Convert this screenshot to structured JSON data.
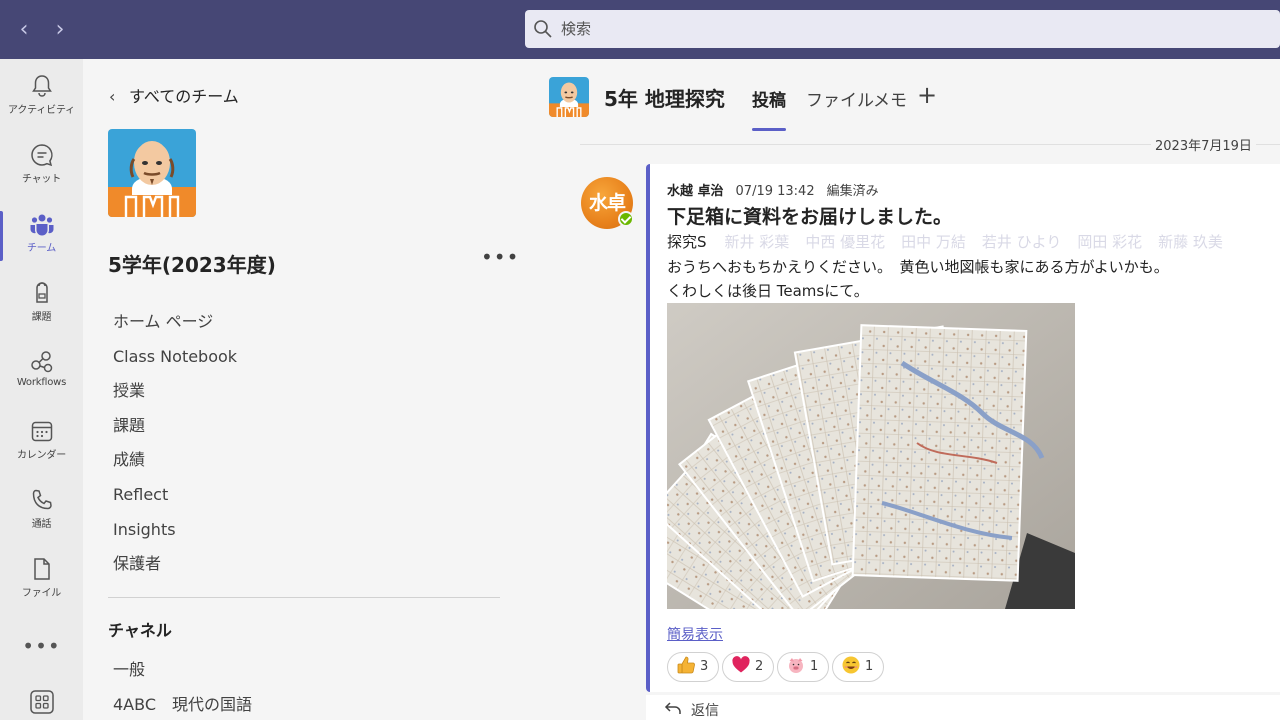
{
  "search": {
    "placeholder": "検索"
  },
  "rail": {
    "items": [
      {
        "label": "アクティビティ",
        "icon": "bell-icon"
      },
      {
        "label": "チャット",
        "icon": "chat-icon"
      },
      {
        "label": "チーム",
        "icon": "teams-icon",
        "active": true
      },
      {
        "label": "課題",
        "icon": "backpack-icon"
      },
      {
        "label": "Workflows",
        "icon": "workflows-icon"
      },
      {
        "label": "カレンダー",
        "icon": "calendar-icon"
      },
      {
        "label": "通話",
        "icon": "phone-icon"
      },
      {
        "label": "ファイル",
        "icon": "file-icon"
      }
    ],
    "more": "•••"
  },
  "team_panel": {
    "back_label": "すべてのチーム",
    "team_name": "5学年(2023年度)",
    "more": "•••",
    "menu": [
      "ホーム ページ",
      "Class Notebook",
      "授業",
      "課題",
      "成績",
      "Reflect",
      "Insights",
      "保護者"
    ],
    "channels_heading": "チャネル",
    "channels": [
      "一般",
      "4ABC　現代の国語"
    ]
  },
  "channel": {
    "title": "5年 地理探究",
    "tabs": [
      "投稿",
      "ファイル",
      "メモ"
    ],
    "active_tab": "投稿"
  },
  "feed": {
    "date": "2023年7月19日",
    "post": {
      "avatar_text": "水卓",
      "author": "水越 卓治",
      "time": "07/19 13:42",
      "edited": "編集済み",
      "subject": "下足箱に資料をお届けしました。",
      "line1_prefix": "探究S",
      "mentions": [
        "新井 彩葉",
        "中西 優里花",
        "田中 万結",
        "若井 ひより",
        "岡田 彩花",
        "新藤 玖美"
      ],
      "line2": "おうちへおもちかえりください。　黄色い地図帳も家にある方がよいかも。",
      "line3": "くわしくは後日 Teamsにて。",
      "collapse_link": "簡易表示",
      "reactions": [
        {
          "emoji": "thumbs-up",
          "count": "3"
        },
        {
          "emoji": "heart",
          "count": "2"
        },
        {
          "emoji": "pig",
          "count": "1"
        },
        {
          "emoji": "smile",
          "count": "1"
        }
      ]
    },
    "reply_label": "返信"
  },
  "colors": {
    "topbar": "#464775",
    "accent": "#5b5fc7",
    "presence": "#6bb700",
    "avatar": "#e8821c"
  }
}
